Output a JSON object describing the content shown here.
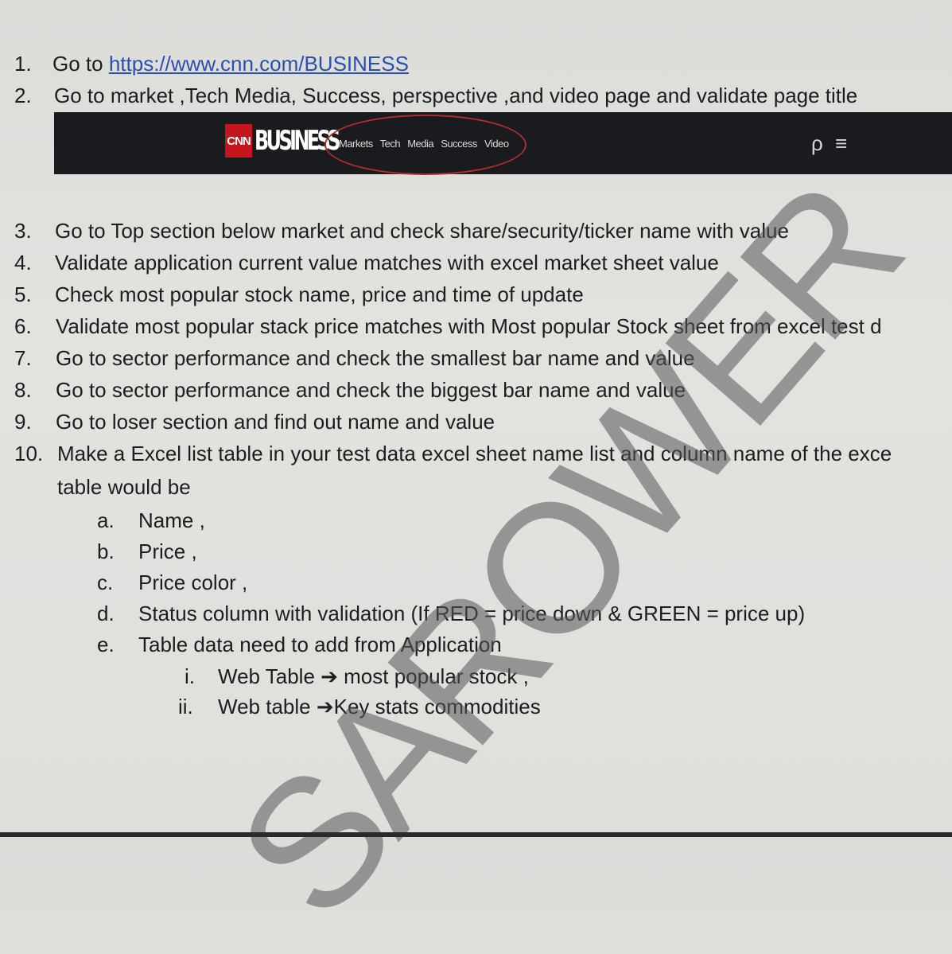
{
  "items": [
    {
      "num": "1.",
      "prefix": "Go to ",
      "link": "https://www.cnn.com/BUSINESS"
    },
    {
      "num": "2.",
      "text": "Go to market ,Tech Media, Success, perspective ,and video page and validate page title"
    },
    {
      "num": "3.",
      "text": "Go to Top section below market and check share/security/ticker name with value"
    },
    {
      "num": "4.",
      "text": "Validate application current value matches with excel market sheet value"
    },
    {
      "num": "5.",
      "text": "Check most popular stock name, price and time of update"
    },
    {
      "num": "6.",
      "text": "Validate most popular stack price matches with Most popular Stock sheet from excel test d"
    },
    {
      "num": "7.",
      "text": "Go to sector performance and check the smallest bar name and value"
    },
    {
      "num": "8.",
      "text": "Go to sector performance and check the biggest bar name and value"
    },
    {
      "num": "9.",
      "text": "Go to loser section and find out name and value"
    },
    {
      "num": "10.",
      "text": "Make a Excel list  table in your test data excel sheet name list and column name of the exce",
      "cont": "table would be"
    }
  ],
  "subitems": [
    {
      "num": "a.",
      "text": "Name ,"
    },
    {
      "num": "b.",
      "text": "Price  ,"
    },
    {
      "num": "c.",
      "text": "Price color ,"
    },
    {
      "num": "d.",
      "text": "Status column with validation (If RED = price down & GREEN = price up)"
    },
    {
      "num": "e.",
      "text": "Table data need to add from Application"
    }
  ],
  "subsubitems": [
    {
      "num": "i.",
      "pre": "Web Table ",
      "arrow": "➔",
      "post": " most popular stock ,"
    },
    {
      "num": "ii.",
      "pre": "Web table ",
      "arrow": "➔",
      "post": "Key stats commodities"
    }
  ],
  "banner": {
    "logo_cnn": "CNN",
    "logo_business": "BUSINESS",
    "nav": [
      "Markets",
      "Tech",
      "Media",
      "Success",
      "Video"
    ],
    "search_icon": "search-icon",
    "menu_icon": "hamburger-menu-icon"
  },
  "watermark": "SAROWER"
}
